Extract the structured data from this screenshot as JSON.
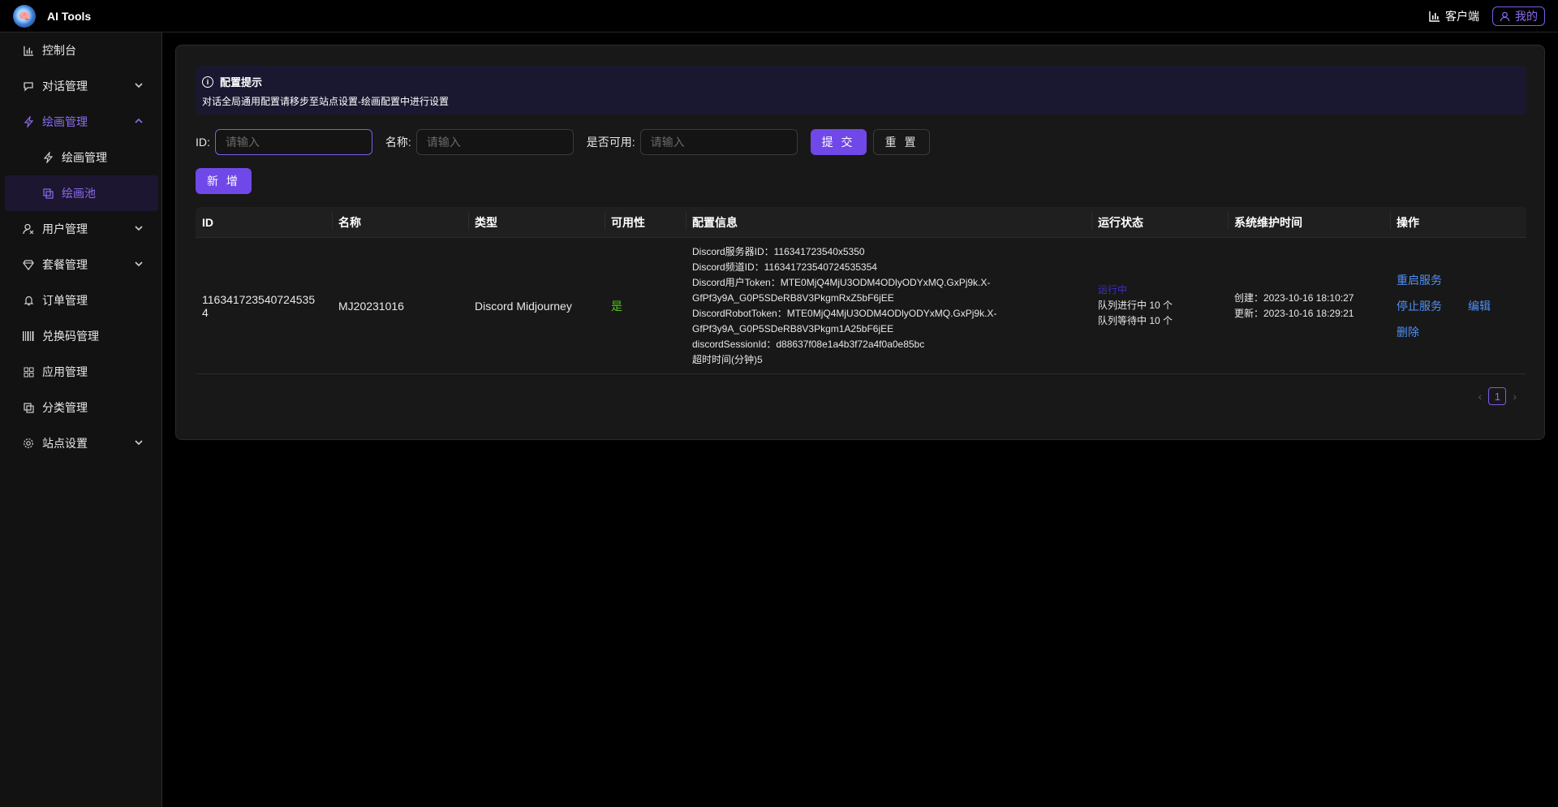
{
  "app": {
    "title": "AI Tools"
  },
  "header": {
    "client_label": "客户端",
    "mine_label": "我的"
  },
  "sidebar": {
    "items": [
      {
        "label": "控制台",
        "icon": "chart-icon"
      },
      {
        "label": "对话管理",
        "icon": "chat-icon"
      },
      {
        "label": "绘画管理",
        "icon": "bolt-icon"
      },
      {
        "label": "绘画管理",
        "icon": "bolt-icon"
      },
      {
        "label": "绘画池",
        "icon": "copy-icon"
      },
      {
        "label": "用户管理",
        "icon": "user-icon"
      },
      {
        "label": "套餐管理",
        "icon": "diamond-icon"
      },
      {
        "label": "订单管理",
        "icon": "bell-icon"
      },
      {
        "label": "兑换码管理",
        "icon": "barcode-icon"
      },
      {
        "label": "应用管理",
        "icon": "grid-icon"
      },
      {
        "label": "分类管理",
        "icon": "copy-icon"
      },
      {
        "label": "站点设置",
        "icon": "gear-icon"
      }
    ]
  },
  "alert": {
    "title": "配置提示",
    "desc": "对话全局通用配置请移步至站点设置-绘画配置中进行设置"
  },
  "filters": {
    "id_label": "ID:",
    "name_label": "名称:",
    "available_label": "是否可用:",
    "placeholder": "请输入",
    "submit_label": "提 交",
    "reset_label": "重 置"
  },
  "add_label": "新 增",
  "table": {
    "headers": [
      "ID",
      "名称",
      "类型",
      "可用性",
      "配置信息",
      "运行状态",
      "系统维护时间",
      "操作"
    ],
    "rows": [
      {
        "id_line1": "116341723540724535",
        "id_line2": "4",
        "name": "MJ20231016",
        "type": "Discord Midjourney",
        "available": "是",
        "config": [
          "Discord服务器ID：116341723540x5350",
          "Discord频道ID：116341723540724535354",
          "Discord用户Token：MTE0MjQ4MjU3ODM4ODlyODYxMQ.GxPj9k.X-",
          "GfPf3y9A_G0P5SDeRB8V3PkgmRxZ5bF6jEE",
          "DiscordRobotToken：MTE0MjQ4MjU3ODM4ODlyODYxMQ.GxPj9k.X-",
          "GfPf3y9A_G0P5SDeRB8V3Pkgm1A25bF6jEE",
          "discordSessionId：d88637f08e1a4b3f72a4f0a0e85bc",
          "超时时间(分钟)5"
        ],
        "status": "运行中",
        "queue_running": "队列进行中 10 个",
        "queue_waiting": "队列等待中 10 个",
        "created": "创建：2023-10-16 18:10:27",
        "updated": "更新：2023-10-16 18:29:21",
        "ops": {
          "restart": "重启服务",
          "stop": "停止服务",
          "edit": "编辑",
          "delete": "删除"
        }
      }
    ]
  },
  "pagination": {
    "current": "1"
  }
}
